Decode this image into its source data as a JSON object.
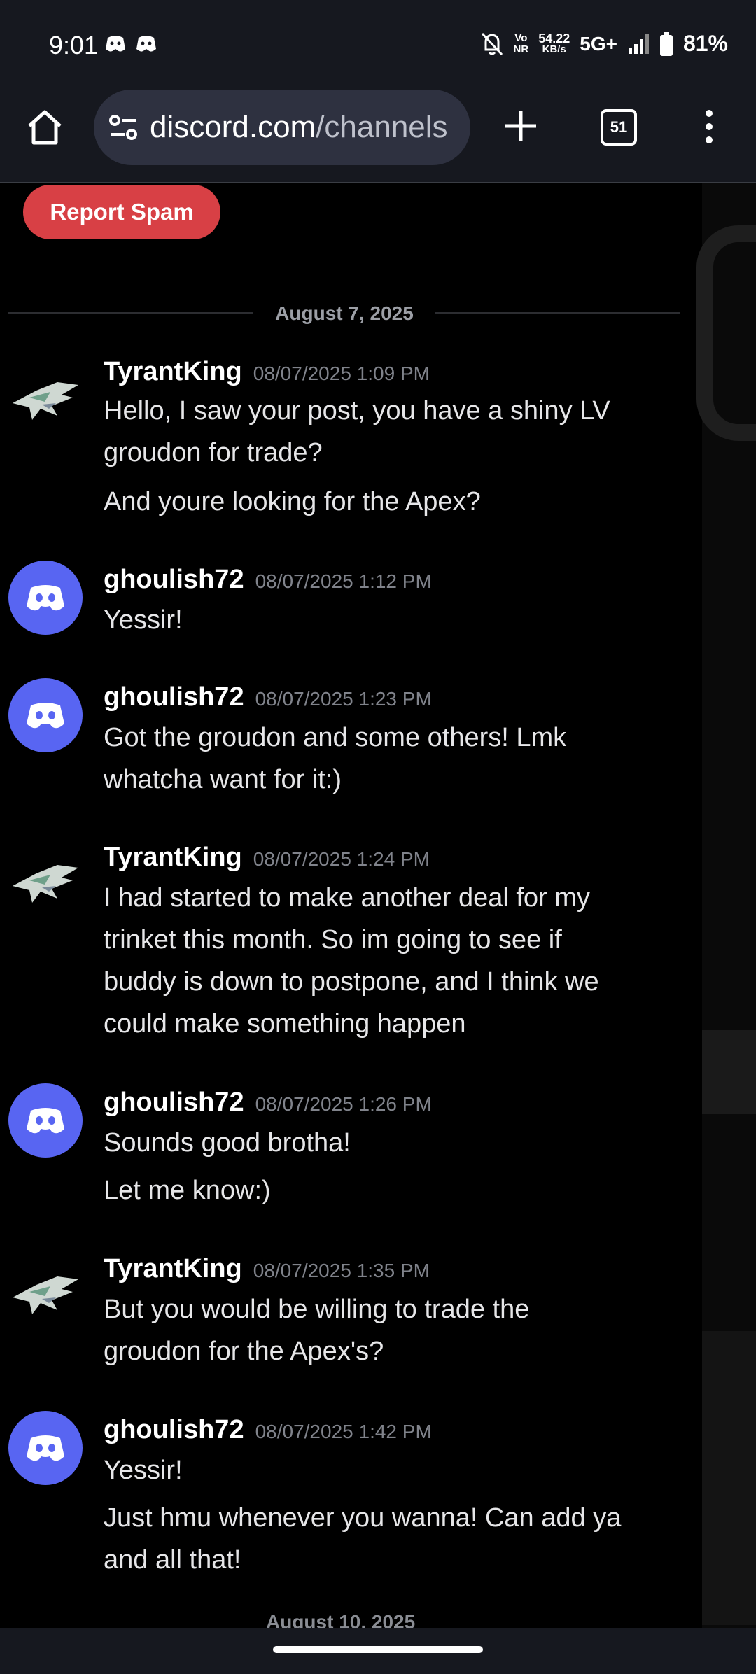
{
  "status_bar": {
    "time": "9:01",
    "volte_top": "Vo",
    "volte_bottom": "NR",
    "speed_value": "54.22",
    "speed_unit": "KB/s",
    "network": "5G+",
    "battery": "81%"
  },
  "browser": {
    "url_host": "discord.com",
    "url_path": "/channels",
    "tab_count": "51"
  },
  "chat": {
    "report_label": "Report Spam",
    "date_divider": "August 7, 2025",
    "partial_divider": "August 10, 2025",
    "messages": [
      {
        "author": "TyrantKing",
        "time": "08/07/2025 1:09 PM",
        "avatar": "pokemon-avatar",
        "lines": [
          "Hello, I saw your post, you have a shiny LV",
          "groudon for trade?",
          "And youre looking for the Apex?"
        ]
      },
      {
        "author": "ghoulish72",
        "time": "08/07/2025 1:12 PM",
        "avatar": "discord-avatar",
        "lines": [
          "Yessir!"
        ]
      },
      {
        "author": "ghoulish72",
        "time": "08/07/2025 1:23 PM",
        "avatar": "discord-avatar",
        "lines": [
          "Got the groudon and some others! Lmk",
          "whatcha want for it:)"
        ]
      },
      {
        "author": "TyrantKing",
        "time": "08/07/2025 1:24 PM",
        "avatar": "pokemon-avatar",
        "lines": [
          "I had started to make another deal for my",
          "trinket this month. So im going to see if",
          "buddy is down to postpone, and I think we",
          "could make something happen"
        ]
      },
      {
        "author": "ghoulish72",
        "time": "08/07/2025 1:26 PM",
        "avatar": "discord-avatar",
        "lines": [
          "Sounds good brotha!",
          "Let me know:)"
        ]
      },
      {
        "author": "TyrantKing",
        "time": "08/07/2025 1:35 PM",
        "avatar": "pokemon-avatar",
        "lines": [
          "But you would be willing to trade the",
          "groudon for the Apex's?"
        ]
      },
      {
        "author": "ghoulish72",
        "time": "08/07/2025 1:42 PM",
        "avatar": "discord-avatar",
        "lines": [
          "Yessir!",
          "Just hmu whenever you wanna! Can add ya",
          "and all that!"
        ]
      }
    ]
  },
  "colors": {
    "accent_red": "#d84045",
    "discord_blurple": "#5865f2",
    "background": "#000000"
  }
}
